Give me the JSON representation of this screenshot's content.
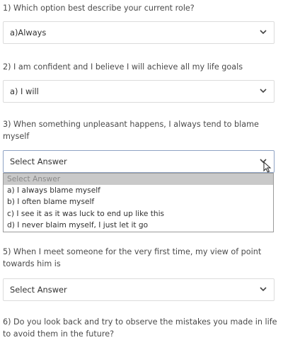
{
  "questions": [
    {
      "text": "1) Which option best describe your current role?",
      "selected": "a)Always"
    },
    {
      "text": "2) I am confident and I believe I will achieve all my life goals",
      "selected": "a) I will"
    },
    {
      "text": "3) When something unpleasant happens, I always tend to blame myself",
      "selected": "Select Answer"
    },
    {
      "text": "5) When I meet someone for the very first time, my view of point towards him is",
      "selected": "Select Answer"
    },
    {
      "text": "6) Do you look back and try to observe the mistakes you made in life to avoid them in the future?"
    }
  ],
  "dropdown": {
    "options": [
      "Select Answer",
      "a) I always blame myself",
      "b) I often blame myself",
      "c) I see it as it was luck to end up like this",
      "d) I never blaim myself, I just let it go"
    ]
  },
  "icons": {
    "chevron": "chevron-down-icon",
    "cursor": "mouse-pointer-icon"
  }
}
